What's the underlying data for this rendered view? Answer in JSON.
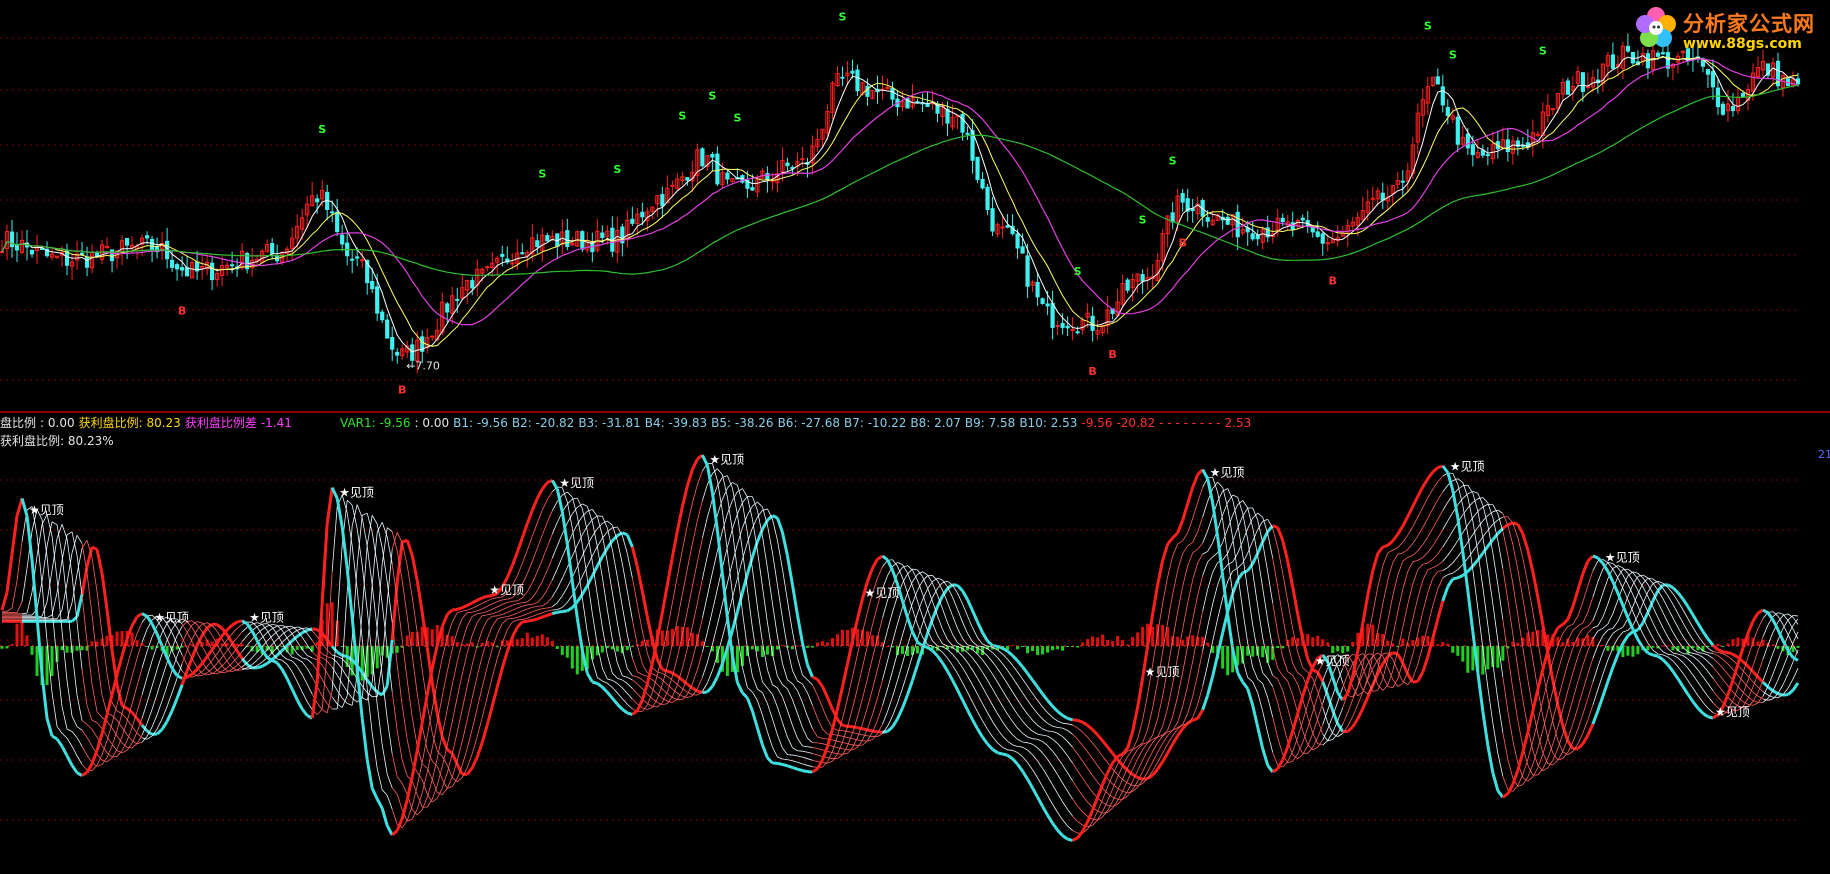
{
  "upper_legend": [
    {
      "text": "盘比例",
      "color": "#e6e6e6"
    },
    {
      "text": ": 0.00",
      "color": "#e6e6e6"
    },
    {
      "text": "获利盘比例: 80.23",
      "color": "#ffd700"
    },
    {
      "text": "获利盘比例差",
      "color": "#ff3cff"
    },
    {
      "text": "-1.41",
      "color": "#ff3cff"
    }
  ],
  "lower_title": "获利盘比例: 80.23%",
  "var_legend": [
    {
      "text": "VAR1: -9.56",
      "color": "#30e030"
    },
    {
      "text": ": 0.00",
      "color": "#e6e6e6"
    },
    {
      "text": "B1: -9.56",
      "color": "#87ceeb"
    },
    {
      "text": "B2: -20.82",
      "color": "#87ceeb"
    },
    {
      "text": "B3: -31.81",
      "color": "#87ceeb"
    },
    {
      "text": "B4: -39.83",
      "color": "#87ceeb"
    },
    {
      "text": "B5: -38.26",
      "color": "#87ceeb"
    },
    {
      "text": "B6: -27.68",
      "color": "#87ceeb"
    },
    {
      "text": "B7: -10.22",
      "color": "#87ceeb"
    },
    {
      "text": "B8: 2.07",
      "color": "#87ceeb"
    },
    {
      "text": "B9: 7.58",
      "color": "#87ceeb"
    },
    {
      "text": "B10: 2.53",
      "color": "#87ceeb"
    },
    {
      "text": "-9.56",
      "color": "#ff3030"
    },
    {
      "text": "-20.82",
      "color": "#ff3030"
    },
    {
      "text": "- - - - - - - -",
      "color": "#ff3030"
    },
    {
      "text": "2.53",
      "color": "#ff3030"
    }
  ],
  "logo": {
    "name": "分析家公式网",
    "url": "www.88gs.com"
  },
  "right_tag": "21",
  "price_low_label": "7.70",
  "peak_label": "见顶",
  "signal_labels": {
    "sell": "S",
    "buy": "B"
  },
  "colors": {
    "up": "#ff2020",
    "down": "#3ff0f0",
    "ma_fast": "#ffffff",
    "ma_mid": "#ffff66",
    "ma_slow": "#e040e0",
    "ma_long": "#30c030",
    "osc_up": "#ff2020",
    "osc_down": "#40e0e0",
    "grid": "#7a0000",
    "divider": "#c00000"
  },
  "chart_data": [
    {
      "type": "candlestick",
      "title": "",
      "x_count": 360,
      "ylim": [
        7.0,
        12.8
      ],
      "price_path": [
        {
          "x": 0,
          "y": 9.5
        },
        {
          "x": 12,
          "y": 9.2
        },
        {
          "x": 30,
          "y": 9.4
        },
        {
          "x": 38,
          "y": 9.0
        },
        {
          "x": 55,
          "y": 9.3
        },
        {
          "x": 63,
          "y": 10.2
        },
        {
          "x": 70,
          "y": 9.2
        },
        {
          "x": 80,
          "y": 7.7
        },
        {
          "x": 95,
          "y": 8.9
        },
        {
          "x": 106,
          "y": 9.5
        },
        {
          "x": 122,
          "y": 9.5
        },
        {
          "x": 132,
          "y": 10.2
        },
        {
          "x": 140,
          "y": 10.8
        },
        {
          "x": 146,
          "y": 10.3
        },
        {
          "x": 160,
          "y": 10.7
        },
        {
          "x": 168,
          "y": 12.0
        },
        {
          "x": 180,
          "y": 11.7
        },
        {
          "x": 190,
          "y": 11.5
        },
        {
          "x": 200,
          "y": 9.6
        },
        {
          "x": 210,
          "y": 8.3
        },
        {
          "x": 218,
          "y": 8.2
        },
        {
          "x": 228,
          "y": 8.9
        },
        {
          "x": 236,
          "y": 10.1
        },
        {
          "x": 248,
          "y": 9.7
        },
        {
          "x": 258,
          "y": 9.7
        },
        {
          "x": 265,
          "y": 9.5
        },
        {
          "x": 278,
          "y": 10.2
        },
        {
          "x": 286,
          "y": 11.9
        },
        {
          "x": 294,
          "y": 10.8
        },
        {
          "x": 303,
          "y": 11.0
        },
        {
          "x": 315,
          "y": 12.0
        },
        {
          "x": 325,
          "y": 12.4
        },
        {
          "x": 338,
          "y": 12.3
        },
        {
          "x": 345,
          "y": 11.6
        },
        {
          "x": 352,
          "y": 12.2
        },
        {
          "x": 359,
          "y": 11.9
        }
      ],
      "sell_signals": [
        64,
        108,
        123,
        136,
        142,
        147,
        168,
        215,
        228,
        234,
        285,
        290,
        308
      ],
      "buy_signals": [
        36,
        80,
        218,
        222,
        236,
        266
      ],
      "low_marker": {
        "x": 80,
        "label": "7.70"
      }
    },
    {
      "type": "line",
      "title": "获利盘比例",
      "x_count": 360,
      "ylim": [
        -100,
        100
      ],
      "series_count": 10,
      "b_values_latest": [
        -9.56,
        -20.82,
        -31.81,
        -39.83,
        -38.26,
        -27.68,
        -10.22,
        2.07,
        7.58,
        2.53
      ],
      "path": [
        {
          "x": 0,
          "y": 20
        },
        {
          "x": 4,
          "y": 82
        },
        {
          "x": 10,
          "y": -50
        },
        {
          "x": 16,
          "y": -72
        },
        {
          "x": 28,
          "y": 18
        },
        {
          "x": 36,
          "y": -18
        },
        {
          "x": 48,
          "y": 14
        },
        {
          "x": 54,
          "y": -8
        },
        {
          "x": 62,
          "y": -40
        },
        {
          "x": 66,
          "y": 88
        },
        {
          "x": 75,
          "y": -85
        },
        {
          "x": 78,
          "y": -105
        },
        {
          "x": 90,
          "y": 20
        },
        {
          "x": 98,
          "y": 28
        },
        {
          "x": 110,
          "y": 92
        },
        {
          "x": 118,
          "y": -20
        },
        {
          "x": 126,
          "y": -38
        },
        {
          "x": 140,
          "y": 106
        },
        {
          "x": 148,
          "y": -26
        },
        {
          "x": 154,
          "y": -65
        },
        {
          "x": 162,
          "y": -70
        },
        {
          "x": 176,
          "y": 50
        },
        {
          "x": 184,
          "y": 0
        },
        {
          "x": 200,
          "y": -60
        },
        {
          "x": 214,
          "y": -108
        },
        {
          "x": 224,
          "y": -60
        },
        {
          "x": 234,
          "y": 60
        },
        {
          "x": 240,
          "y": 98
        },
        {
          "x": 248,
          "y": -20
        },
        {
          "x": 254,
          "y": -70
        },
        {
          "x": 264,
          "y": -5
        },
        {
          "x": 268,
          "y": -30
        },
        {
          "x": 276,
          "y": 55
        },
        {
          "x": 288,
          "y": 100
        },
        {
          "x": 300,
          "y": -84
        },
        {
          "x": 312,
          "y": 12
        },
        {
          "x": 318,
          "y": 50
        },
        {
          "x": 330,
          "y": -5
        },
        {
          "x": 342,
          "y": -40
        },
        {
          "x": 352,
          "y": 20
        },
        {
          "x": 359,
          "y": -8
        }
      ],
      "peaks": [
        5,
        30,
        49,
        67,
        97,
        111,
        141,
        172,
        228,
        241,
        289,
        320,
        342,
        262
      ]
    }
  ]
}
